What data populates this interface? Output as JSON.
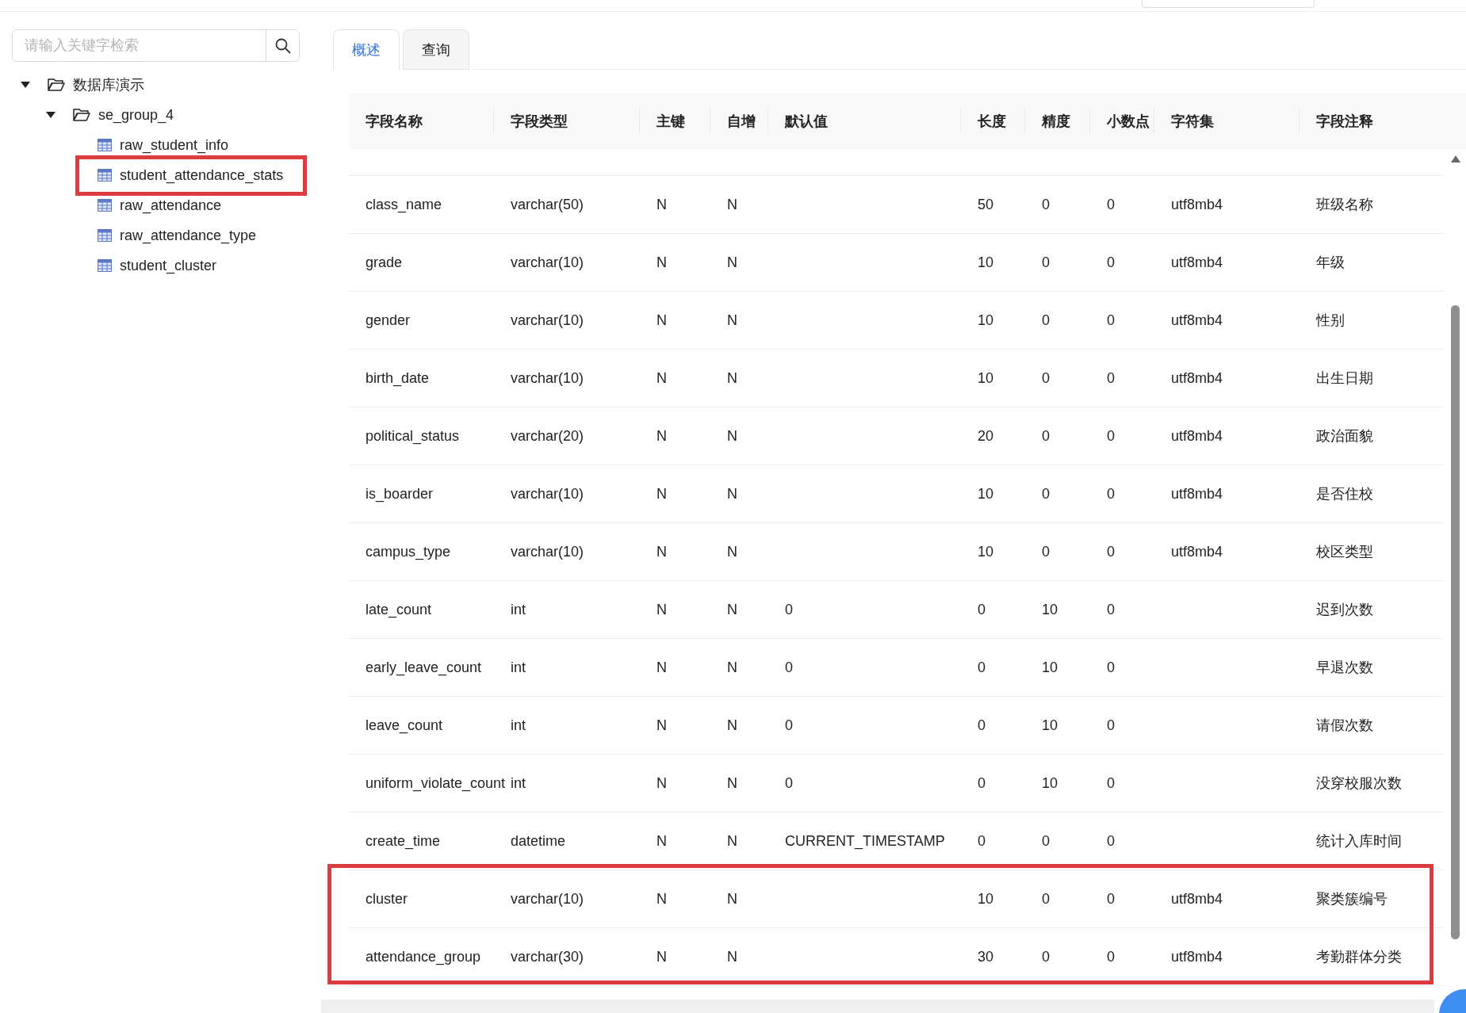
{
  "search": {
    "placeholder": "请输入关键字检索"
  },
  "tree": [
    {
      "label": "数据库演示",
      "expanded": true,
      "children": [
        {
          "label": "se_group_4",
          "expanded": true,
          "children": [
            {
              "label": "raw_student_info",
              "highlighted": false
            },
            {
              "label": "student_attendance_stats",
              "highlighted": true
            },
            {
              "label": "raw_attendance",
              "highlighted": false
            },
            {
              "label": "raw_attendance_type",
              "highlighted": false
            },
            {
              "label": "student_cluster",
              "highlighted": false
            }
          ]
        }
      ]
    }
  ],
  "tabs": [
    {
      "label": "概述",
      "selected": true
    },
    {
      "label": "查询",
      "selected": false
    }
  ],
  "table": {
    "columns": [
      "字段名称",
      "字段类型",
      "主键",
      "自增",
      "默认值",
      "长度",
      "精度",
      "小数点",
      "字符集",
      "字段注释"
    ],
    "rows": [
      {
        "cells": [
          "class_name",
          "varchar(50)",
          "N",
          "N",
          null,
          "50",
          "0",
          "0",
          "utf8mb4",
          "班级名称"
        ],
        "highlighted": false
      },
      {
        "cells": [
          "grade",
          "varchar(10)",
          "N",
          "N",
          null,
          "10",
          "0",
          "0",
          "utf8mb4",
          "年级"
        ],
        "highlighted": false
      },
      {
        "cells": [
          "gender",
          "varchar(10)",
          "N",
          "N",
          null,
          "10",
          "0",
          "0",
          "utf8mb4",
          "性别"
        ],
        "highlighted": false
      },
      {
        "cells": [
          "birth_date",
          "varchar(10)",
          "N",
          "N",
          null,
          "10",
          "0",
          "0",
          "utf8mb4",
          "出生日期"
        ],
        "highlighted": false
      },
      {
        "cells": [
          "political_status",
          "varchar(20)",
          "N",
          "N",
          null,
          "20",
          "0",
          "0",
          "utf8mb4",
          "政治面貌"
        ],
        "highlighted": false
      },
      {
        "cells": [
          "is_boarder",
          "varchar(10)",
          "N",
          "N",
          null,
          "10",
          "0",
          "0",
          "utf8mb4",
          "是否住校"
        ],
        "highlighted": false
      },
      {
        "cells": [
          "campus_type",
          "varchar(10)",
          "N",
          "N",
          null,
          "10",
          "0",
          "0",
          "utf8mb4",
          "校区类型"
        ],
        "highlighted": false
      },
      {
        "cells": [
          "late_count",
          "int",
          "N",
          "N",
          "0",
          "0",
          "10",
          "0",
          null,
          "迟到次数"
        ],
        "highlighted": false
      },
      {
        "cells": [
          "early_leave_count",
          "int",
          "N",
          "N",
          "0",
          "0",
          "10",
          "0",
          null,
          "早退次数"
        ],
        "highlighted": false
      },
      {
        "cells": [
          "leave_count",
          "int",
          "N",
          "N",
          "0",
          "0",
          "10",
          "0",
          null,
          "请假次数"
        ],
        "highlighted": false
      },
      {
        "cells": [
          "uniform_violate_count",
          "int",
          "N",
          "N",
          "0",
          "0",
          "10",
          "0",
          null,
          "没穿校服次数"
        ],
        "highlighted": false
      },
      {
        "cells": [
          "create_time",
          "datetime",
          "N",
          "N",
          "CURRENT_TIMESTAMP",
          "0",
          "0",
          "0",
          null,
          "统计入库时间"
        ],
        "highlighted": false
      },
      {
        "cells": [
          "cluster",
          "varchar(10)",
          "N",
          "N",
          null,
          "10",
          "0",
          "0",
          "utf8mb4",
          "聚类簇编号"
        ],
        "highlighted": true
      },
      {
        "cells": [
          "attendance_group",
          "varchar(30)",
          "N",
          "N",
          null,
          "30",
          "0",
          "0",
          "utf8mb4",
          "考勤群体分类"
        ],
        "highlighted": true
      }
    ]
  }
}
